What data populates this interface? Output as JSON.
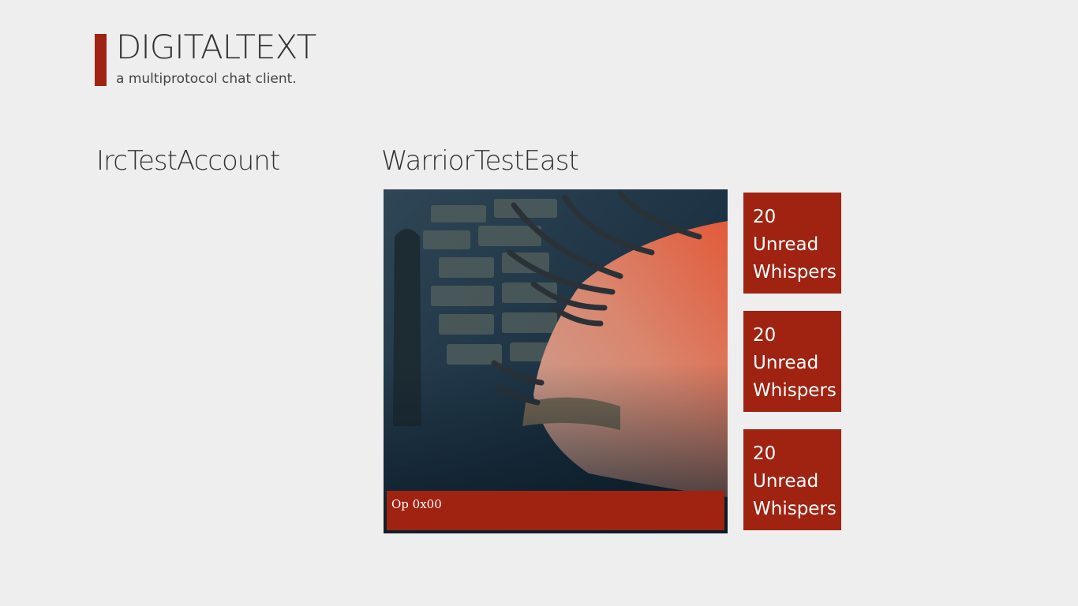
{
  "app": {
    "title": "DIGITALTEXT",
    "subtitle": "a multiprotocol chat client.",
    "accent_color": "#a02312"
  },
  "groups": [
    {
      "header": "IrcTestAccount",
      "tiles": []
    },
    {
      "header": "WarriorTestEast",
      "feature_tile": {
        "caption": "Op 0x00",
        "image": "fantasy-warrior-artwork"
      },
      "whisper_tiles": [
        {
          "count": "20",
          "line1": "Unread",
          "line2": "Whispers"
        },
        {
          "count": "20",
          "line1": "Unread",
          "line2": "Whispers"
        },
        {
          "count": "20",
          "line1": "Unread",
          "line2": "Whispers"
        }
      ]
    }
  ]
}
